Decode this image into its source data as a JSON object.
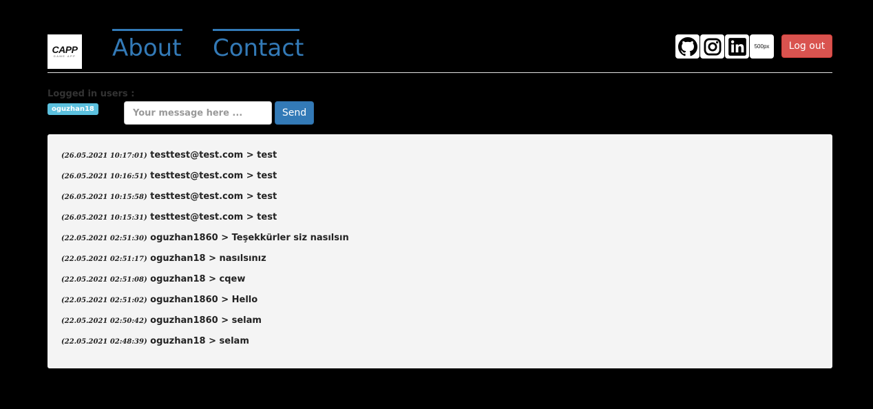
{
  "header": {
    "logo": {
      "main": "CAPP",
      "sub": "GAME APP"
    },
    "nav": [
      {
        "label": "About"
      },
      {
        "label": "Contact"
      }
    ],
    "social": [
      {
        "icon": "github-icon"
      },
      {
        "icon": "instagram-icon"
      },
      {
        "icon": "linkedin-icon"
      },
      {
        "icon": "500px-icon",
        "text": "500px"
      }
    ],
    "logout_label": "Log out"
  },
  "users": {
    "label": "Logged in users :",
    "list": [
      "oguzhan18"
    ]
  },
  "form": {
    "placeholder": "Your message here ...",
    "value": "",
    "send_label": "Send"
  },
  "messages": [
    {
      "time": "(26.05.2021 10:17:01)",
      "text": "testtest@test.com > test"
    },
    {
      "time": "(26.05.2021 10:16:51)",
      "text": "testtest@test.com > test"
    },
    {
      "time": "(26.05.2021 10:15:58)",
      "text": "testtest@test.com > test"
    },
    {
      "time": "(26.05.2021 10:15:31)",
      "text": "testtest@test.com > test"
    },
    {
      "time": "(22.05.2021 02:51:30)",
      "text": "oguzhan1860 > Teşekkürler siz nasılsın"
    },
    {
      "time": "(22.05.2021 02:51:17)",
      "text": "oguzhan18 > nasılsınız"
    },
    {
      "time": "(22.05.2021 02:51:08)",
      "text": "oguzhan18 > cqew"
    },
    {
      "time": "(22.05.2021 02:51:02)",
      "text": "oguzhan1860 > Hello"
    },
    {
      "time": "(22.05.2021 02:50:42)",
      "text": "oguzhan1860 > selam"
    },
    {
      "time": "(22.05.2021 02:48:39)",
      "text": "oguzhan18 > selam"
    }
  ],
  "colors": {
    "background": "#000000",
    "link": "#337ab7",
    "danger": "#d9534f",
    "primary": "#337ab7",
    "badge": "#5bc0de",
    "well": "#f4f4f4"
  }
}
